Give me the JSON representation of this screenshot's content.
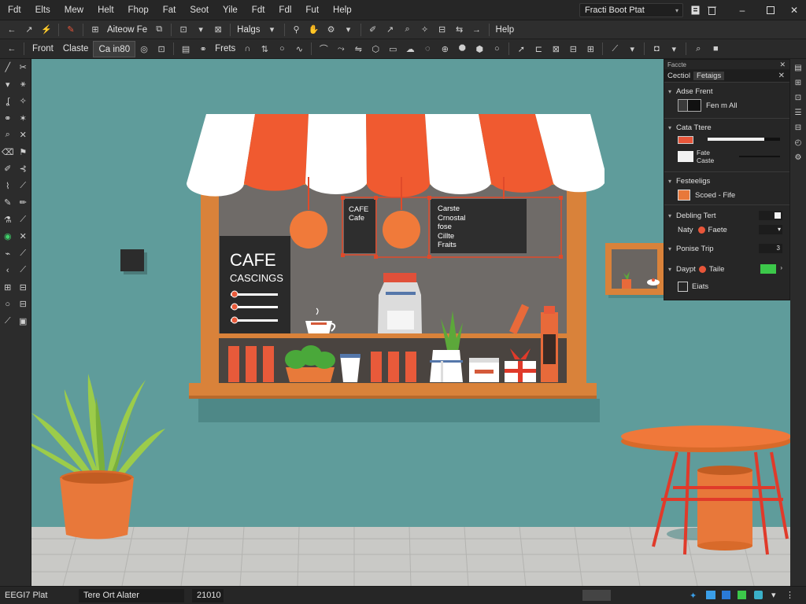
{
  "menubar": {
    "items": [
      "Fdt",
      "Elts",
      "Mew",
      "Helt",
      "Fhop",
      "Fat",
      "Seot",
      "Yile",
      "Fdt",
      "Fdl",
      "Fut",
      "Help"
    ],
    "document_title": "Fracti Boot Ptat"
  },
  "toolbar1": {
    "layer_label": "Aiteow Fe",
    "mode_label": "Halgs",
    "help_label": "Help"
  },
  "toolbar2": {
    "tabs": [
      "Front",
      "Claste",
      "Ca in80"
    ],
    "mode_label": "Frets"
  },
  "canvas": {
    "chalkboard_title": "CAFE",
    "chalkboard_subtitle": "CASCINGS",
    "sign1_lines": [
      "CAFE",
      "Cafe"
    ],
    "sign2_lines": [
      "Carste",
      "Crnostal",
      "fose",
      "Cillte",
      "Fraits"
    ]
  },
  "panel": {
    "header": "Faccte",
    "tabs": [
      "Cectiol",
      "Fetaigs"
    ],
    "sections": {
      "fonts": {
        "title": "Adse Frent",
        "value": "Fen m All"
      },
      "tone": {
        "title": "Cata Ttere",
        "name": "Fate",
        "sub": "Caste",
        "slider": 0.78
      },
      "presets": {
        "title": "Festeeligs",
        "value": "Scoed - Fife"
      },
      "rows": [
        {
          "label": "Debling Tert",
          "value": ""
        },
        {
          "label": "Naty",
          "value": "Faete"
        },
        {
          "label": "Ponise Trip",
          "value": "3"
        },
        {
          "label": "Daypt",
          "value": "Taile"
        },
        {
          "label": "Eiats",
          "value": ""
        }
      ]
    }
  },
  "statusbar": {
    "left": "EEGI7 Plat",
    "middle": "Tere Ort Alater",
    "zoom": "21010"
  },
  "colors": {
    "canvas_bg": "#5f9c9b",
    "awning_red": "#f05a30",
    "shop_frame": "#d9823a",
    "accent_green": "#3fd06a",
    "ui_dark": "#262626"
  }
}
